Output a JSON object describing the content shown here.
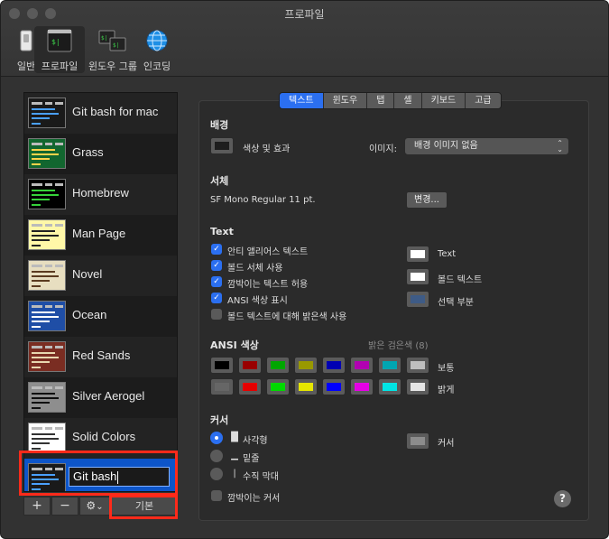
{
  "window": {
    "title": "프로파일",
    "toolbar": [
      "일반",
      "프로파일",
      "윈도우 그룹",
      "인코딩"
    ]
  },
  "sidebar": {
    "profiles": [
      {
        "name": "Git bash for mac",
        "bg": "#1a1a1a",
        "line": "#4aa0ff"
      },
      {
        "name": "Grass",
        "bg": "#12662f",
        "line": "#ffd34a"
      },
      {
        "name": "Homebrew",
        "bg": "#000000",
        "line": "#36d23a"
      },
      {
        "name": "Man Page",
        "bg": "#fff8a8",
        "line": "#222222"
      },
      {
        "name": "Novel",
        "bg": "#e7dec0",
        "line": "#5a3a20"
      },
      {
        "name": "Ocean",
        "bg": "#1f4ea6",
        "line": "#ffffff"
      },
      {
        "name": "Red Sands",
        "bg": "#7a2d22",
        "line": "#e8d8b0"
      },
      {
        "name": "Silver Aerogel",
        "bg": "#8e8e8e",
        "line": "#101010"
      },
      {
        "name": "Solid Colors",
        "bg": "#ffffff",
        "line": "#333333"
      }
    ],
    "editing_value": "Git bash",
    "add_label": "+",
    "remove_label": "−",
    "gear_label": "⚙",
    "gear_arrow": "⌄",
    "default_button": "기본"
  },
  "tabs": [
    "텍스트",
    "윈도우",
    "탭",
    "셸",
    "키보드",
    "고급"
  ],
  "background": {
    "section": "배경",
    "color_effect": "색상 및 효과",
    "image_label": "이미지:",
    "image_value": "배경 이미지 없음",
    "select_arrows": "⌃⌄"
  },
  "font": {
    "section": "서체",
    "value": "SF Mono Regular 11 pt.",
    "change_button": "변경..."
  },
  "text": {
    "section": "Text",
    "options": [
      {
        "label": "안티 앨리어스 텍스트",
        "checked": true
      },
      {
        "label": "볼드 서체 사용",
        "checked": true
      },
      {
        "label": "깜박이는 텍스트 허용",
        "checked": true
      },
      {
        "label": "ANSI 색상 표시",
        "checked": true
      },
      {
        "label": "볼드 텍스트에 대해 밝은색 사용",
        "checked": false
      }
    ],
    "check_glyph": "✓",
    "colors": [
      {
        "label": "Text",
        "color": "#ffffff"
      },
      {
        "label": "볼드 텍스트",
        "color": "#ffffff"
      },
      {
        "label": "선택 부분",
        "color": "#3e5b86"
      }
    ]
  },
  "ansi": {
    "section": "ANSI 색상",
    "bright_hint": "밝은 검은색 (8)",
    "normal_label": "보통",
    "bright_label": "밝게",
    "normal": [
      "#000000",
      "#990000",
      "#00a600",
      "#999900",
      "#0000b2",
      "#b200b2",
      "#00a6b2",
      "#bfbfbf"
    ],
    "bright": [
      "#666666",
      "#e50000",
      "#00d900",
      "#e5e500",
      "#0000ff",
      "#e500e5",
      "#00e5e5",
      "#e5e5e5"
    ]
  },
  "cursor": {
    "section": "커서",
    "options": [
      {
        "glyph": "█",
        "label": "사각형",
        "selected": true
      },
      {
        "glyph": "▁",
        "label": "밑줄",
        "selected": false
      },
      {
        "glyph": "|",
        "label": "수직 막대",
        "selected": false
      }
    ],
    "color_label": "커서",
    "color": "#8c8c8c",
    "blink_label": "깜박이는 커서"
  },
  "help": "?"
}
